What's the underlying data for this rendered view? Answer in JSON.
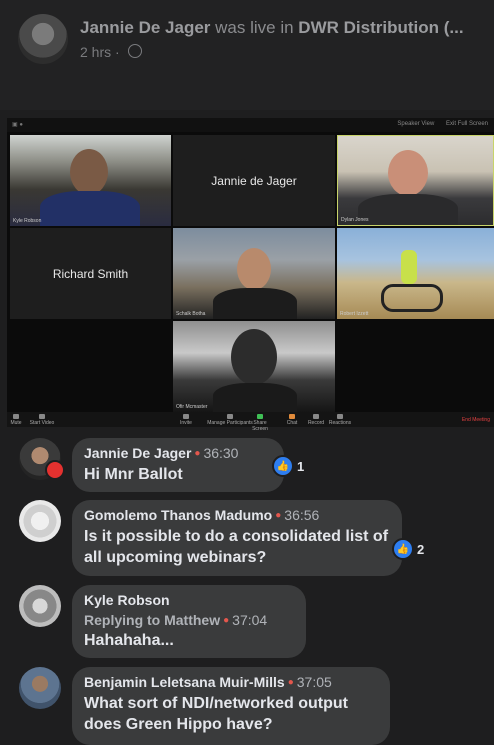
{
  "header": {
    "author": "Jannie De Jager",
    "action": "was live in",
    "group": "DWR Distribution (...",
    "time": "2 hrs",
    "separator": "·"
  },
  "zoom": {
    "top_right": [
      "Speaker View",
      "Exit Full Screen"
    ],
    "tiles": {
      "kyle_tag": "Kyle Robson",
      "jannie_name": "Jannie de Jager",
      "dylan_tag": "Dylan Jones",
      "richard_name": "Richard Smith",
      "schalk_tag": "Schalk Botha",
      "robert_tag": "Robert Izzett",
      "ofir_tag": "Ofir Mcmaster"
    },
    "toolbar": {
      "mute": "Mute",
      "start_video": "Start Video",
      "invite": "Invite",
      "participants": "Manage Participants",
      "share": "Share Screen",
      "chat": "Chat",
      "record": "Record",
      "reactions": "Reactions",
      "end": "End Meeting"
    }
  },
  "comments": [
    {
      "name": "Jannie De Jager",
      "time": "36:30",
      "text": "Hi Mnr Ballot",
      "reactions": "1"
    },
    {
      "name": "Gomolemo Thanos Madumo",
      "time": "36:56",
      "text": "Is it possible to do a consolidated list of all upcoming webinars?",
      "reactions": "2"
    },
    {
      "name": "Kyle Robson",
      "reply_prefix": "Replying to Matthew",
      "time": "37:04",
      "text": "Hahahaha..."
    },
    {
      "name": "Benjamin Leletsana Muir-Mills",
      "time": "37:05",
      "text": "What sort of NDI/networked output does Green Hippo have?"
    }
  ],
  "colors": {
    "background": "#1e1e1f",
    "bubble": "#3a3b3c",
    "like_blue": "#2e7ef0",
    "live_red": "#e4312f"
  },
  "icons": {
    "like": "thumbs-up-icon",
    "privacy": "globe-icon",
    "live": "live-broadcast-icon"
  }
}
